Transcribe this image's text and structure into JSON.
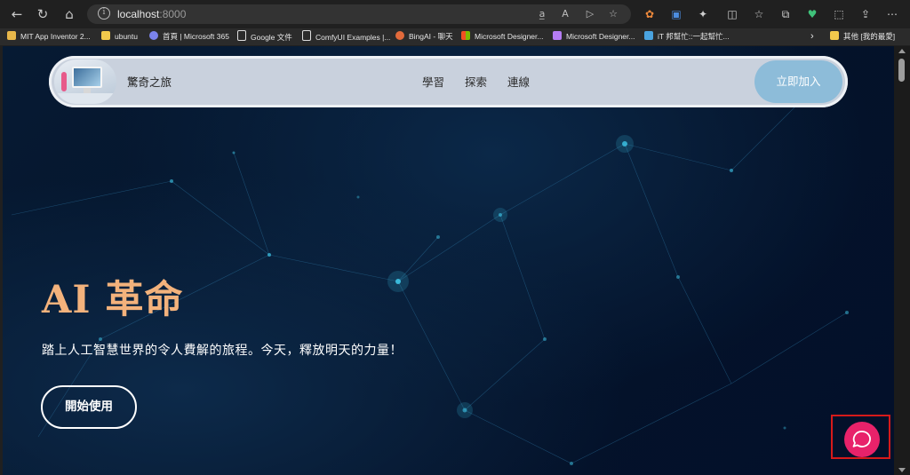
{
  "browser": {
    "url_host": "localhost",
    "url_port": ":8000"
  },
  "bookmarks": [
    {
      "label": "MIT App Inventor 2...",
      "icon": "app-inventor-icon",
      "color": "#e8b74a"
    },
    {
      "label": "ubuntu",
      "icon": "folder-icon",
      "color": "#f2c94c"
    },
    {
      "label": "首頁 | Microsoft 365",
      "icon": "microsoft365-icon",
      "color": "#7b83eb"
    },
    {
      "label": "Google 文件",
      "icon": "document-icon",
      "color": "#dddddd"
    },
    {
      "label": "ComfyUI Examples |...",
      "icon": "document-icon",
      "color": "#dddddd"
    },
    {
      "label": "BingAI - 聊天",
      "icon": "bing-icon",
      "color": "#e26a3b"
    },
    {
      "label": "Microsoft Designer...",
      "icon": "microsoft-icon",
      "color": "#f25022"
    },
    {
      "label": "Microsoft Designer...",
      "icon": "designer-icon",
      "color": "#b57cf3"
    },
    {
      "label": "iT 邦幫忙::一起幫忙...",
      "icon": "ithelp-icon",
      "color": "#4aa3df"
    }
  ],
  "bookmarks_other": {
    "label": "其他 [我的最愛]",
    "color": "#f2c94c"
  },
  "page": {
    "brand": "驚奇之旅",
    "nav": [
      "學習",
      "探索",
      "連線"
    ],
    "join_label": "立即加入",
    "hero_title": "AI 革命",
    "hero_subtitle": "踏上人工智慧世界的令人費解的旅程。今天，釋放明天的力量！",
    "start_label": "開始使用"
  },
  "colors": {
    "accent_title": "#f3b27c",
    "join_button": "#8dbcd9",
    "chat_button": "#e8226a",
    "highlight_box": "#d61a1a"
  }
}
